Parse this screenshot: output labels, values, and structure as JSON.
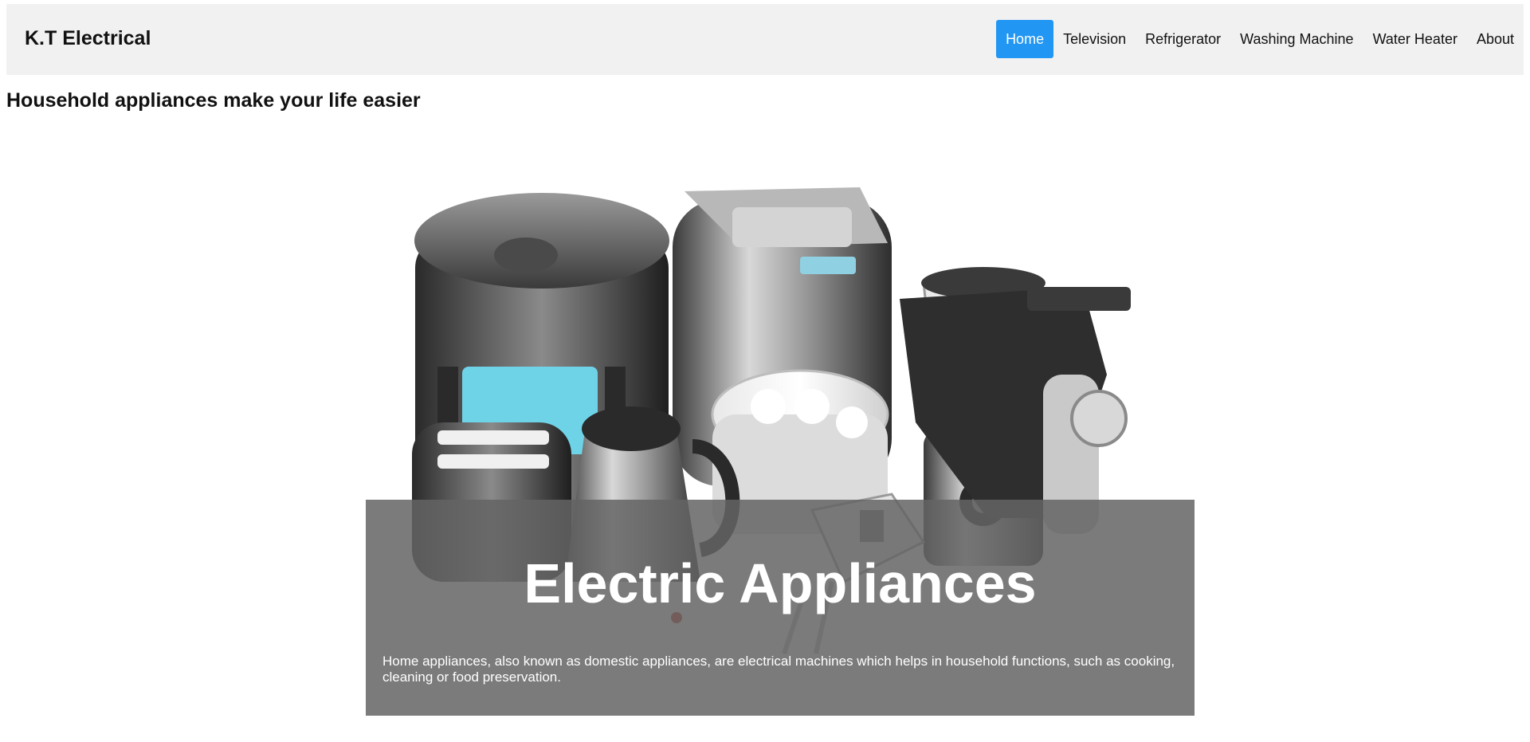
{
  "header": {
    "brand": "K.T Electrical",
    "nav": [
      {
        "label": "Home",
        "active": true
      },
      {
        "label": "Television"
      },
      {
        "label": "Refrigerator"
      },
      {
        "label": "Washing Machine"
      },
      {
        "label": "Water Heater"
      },
      {
        "label": "About"
      }
    ]
  },
  "main": {
    "heading": "Household appliances make your life easier",
    "hero": {
      "image_subject": "kitchen-appliances-photo",
      "caption_title": "Electric Appliances",
      "caption_text": "Home appliances, also known as domestic appliances, are electrical machines which helps in household functions, such as cooking, cleaning or food preservation."
    }
  },
  "colors": {
    "nav_background": "#f1f1f1",
    "active_link": "#2196f3",
    "caption_overlay": "#646464"
  }
}
